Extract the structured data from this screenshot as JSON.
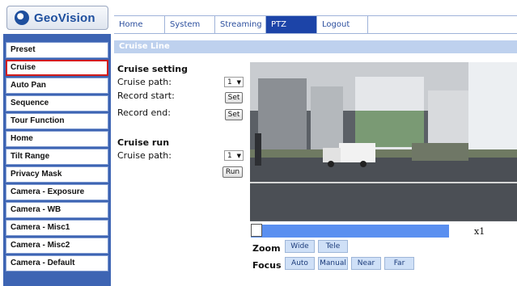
{
  "brand": {
    "name": "GeoVision"
  },
  "topnav": {
    "tabs": [
      {
        "label": "Home",
        "active": false
      },
      {
        "label": "System",
        "active": false
      },
      {
        "label": "Streaming",
        "active": false
      },
      {
        "label": "PTZ",
        "active": true
      },
      {
        "label": "Logout",
        "active": false
      },
      {
        "label": "",
        "active": false
      }
    ]
  },
  "sidebar": {
    "items": [
      {
        "label": "Preset"
      },
      {
        "label": "Cruise",
        "selected": true
      },
      {
        "label": "Auto Pan"
      },
      {
        "label": "Sequence"
      },
      {
        "label": "Tour Function"
      },
      {
        "label": "Home"
      },
      {
        "label": "Tilt Range"
      },
      {
        "label": "Privacy Mask"
      },
      {
        "label": "Camera - Exposure"
      },
      {
        "label": "Camera - WB"
      },
      {
        "label": "Camera - Misc1"
      },
      {
        "label": "Camera - Misc2"
      },
      {
        "label": "Camera - Default"
      }
    ]
  },
  "main": {
    "section_title": "Cruise Line",
    "cruise_setting": {
      "heading": "Cruise setting",
      "path_label": "Cruise path:",
      "path_value": "1",
      "record_start_label": "Record start:",
      "record_end_label": "Record end:",
      "set_label": "Set"
    },
    "cruise_run": {
      "heading": "Cruise run",
      "path_label": "Cruise path:",
      "path_value": "1",
      "run_label": "Run"
    },
    "zoom_level": "x1",
    "zoom": {
      "label": "Zoom",
      "wide": "Wide",
      "tele": "Tele"
    },
    "focus": {
      "label": "Focus",
      "auto": "Auto",
      "manual": "Manual",
      "near": "Near",
      "far": "Far"
    }
  },
  "colors": {
    "sidebar_bg": "#3d64b3",
    "active_tab": "#1c44a8",
    "selected_outline": "#d21b1b",
    "zoom_track": "#5a8ff0"
  }
}
